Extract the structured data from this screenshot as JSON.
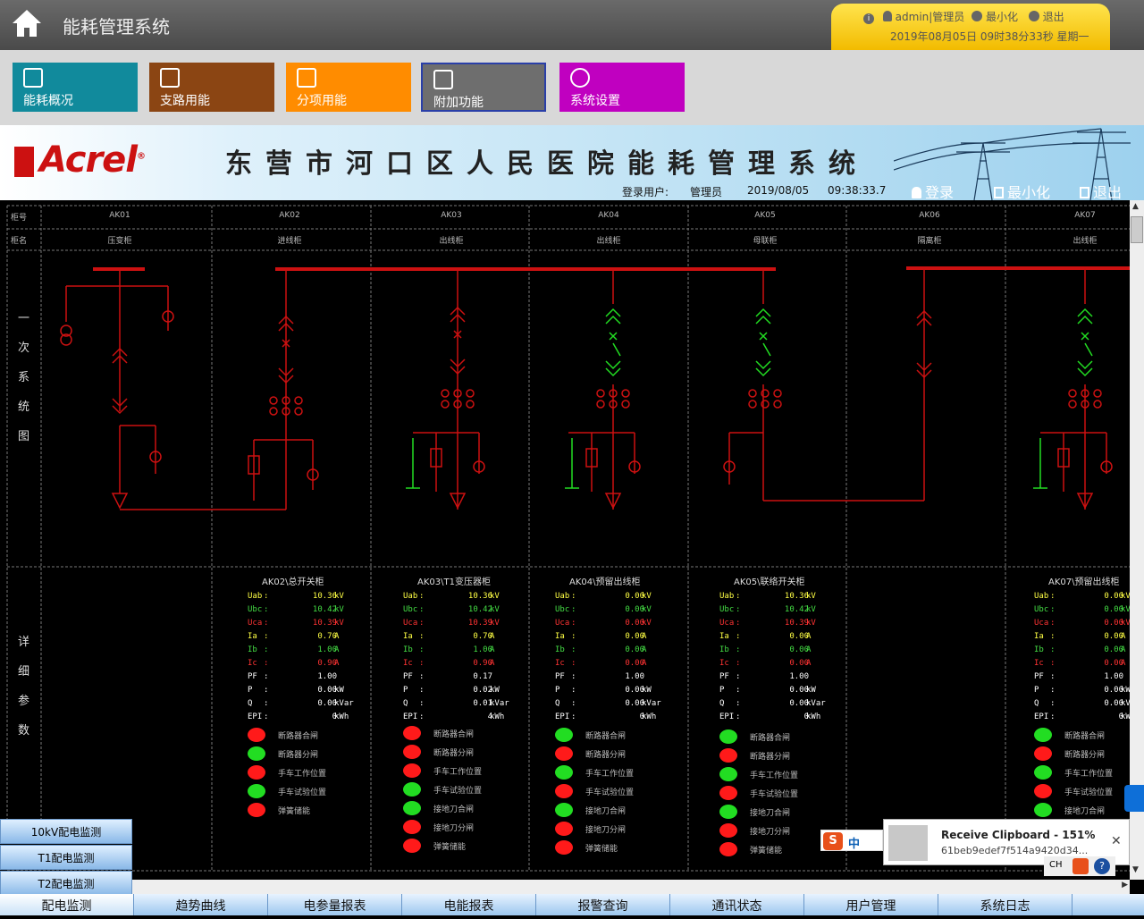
{
  "app": {
    "title": "能耗管理系统"
  },
  "user_box": {
    "user_label": "admin|管理员",
    "minimize": "最小化",
    "exit": "退出",
    "datetime": "2019年08月05日  09时38分33秒  星期一"
  },
  "modules": [
    {
      "label": "能耗概况",
      "color": "#118a9c",
      "icon": "chart-gauge-icon"
    },
    {
      "label": "支路用能",
      "color": "#8b4513",
      "icon": "line-chart-icon"
    },
    {
      "label": "分项用能",
      "color": "#ff8c00",
      "icon": "person-icon"
    },
    {
      "label": "附加功能",
      "color": "#6e6e6e",
      "icon": "pulse-icon"
    },
    {
      "label": "系统设置",
      "color": "#c000c0",
      "icon": "gear-icon"
    }
  ],
  "banner": {
    "logo": "Acrel",
    "title": "东营市河口区人民医院能耗管理系统",
    "login_label": "登录用户:",
    "login_user": "管理员",
    "date": "2019/08/05",
    "time": "09:38:33.7",
    "btn_login": "登录",
    "btn_min": "最小化",
    "btn_exit": "退出"
  },
  "grid": {
    "row_label_no": "柜号",
    "row_label_name": "柜名",
    "section_primary": "一次系统图",
    "section_detail": "详细参数",
    "cabinets": [
      {
        "no": "AK01",
        "name": "压变柜"
      },
      {
        "no": "AK02",
        "name": "进线柜"
      },
      {
        "no": "AK03",
        "name": "出线柜"
      },
      {
        "no": "AK04",
        "name": "出线柜"
      },
      {
        "no": "AK05",
        "name": "母联柜"
      },
      {
        "no": "AK06",
        "name": "隔离柜"
      },
      {
        "no": "AK07",
        "name": "出线柜"
      }
    ]
  },
  "panels": [
    {
      "title": "AK02\\总开关柜",
      "rows": [
        {
          "k": "Uab",
          "v": "10.36",
          "u": "kV",
          "c": "#ffff44"
        },
        {
          "k": "Ubc",
          "v": "10.42",
          "u": "kV",
          "c": "#44dd44"
        },
        {
          "k": "Uca",
          "v": "10.39",
          "u": "kV",
          "c": "#ff3333"
        },
        {
          "k": "Ia",
          "v": "0.70",
          "u": "A",
          "c": "#ffff44"
        },
        {
          "k": "Ib",
          "v": "1.00",
          "u": "A",
          "c": "#44dd44"
        },
        {
          "k": "Ic",
          "v": "0.90",
          "u": "A",
          "c": "#ff3333"
        },
        {
          "k": "PF",
          "v": "1.00",
          "u": "",
          "c": "#ffffff"
        },
        {
          "k": "P",
          "v": "0.00",
          "u": "kW",
          "c": "#ffffff"
        },
        {
          "k": "Q",
          "v": "0.00",
          "u": "kVar",
          "c": "#ffffff"
        },
        {
          "k": "EPI",
          "v": "0",
          "u": "kWh",
          "c": "#ffffff"
        }
      ],
      "status": [
        {
          "t": "断路器合闸",
          "on": false
        },
        {
          "t": "断路器分闸",
          "on": true
        },
        {
          "t": "手车工作位置",
          "on": false
        },
        {
          "t": "手车试验位置",
          "on": true
        },
        {
          "t": "弹簧储能",
          "on": false
        }
      ]
    },
    {
      "title": "AK03\\T1变压器柜",
      "rows": [
        {
          "k": "Uab",
          "v": "10.36",
          "u": "kV",
          "c": "#ffff44"
        },
        {
          "k": "Ubc",
          "v": "10.42",
          "u": "kV",
          "c": "#44dd44"
        },
        {
          "k": "Uca",
          "v": "10.39",
          "u": "kV",
          "c": "#ff3333"
        },
        {
          "k": "Ia",
          "v": "0.70",
          "u": "A",
          "c": "#ffff44"
        },
        {
          "k": "Ib",
          "v": "1.00",
          "u": "A",
          "c": "#44dd44"
        },
        {
          "k": "Ic",
          "v": "0.90",
          "u": "A",
          "c": "#ff3333"
        },
        {
          "k": "PF",
          "v": "0.17",
          "u": "",
          "c": "#ffffff"
        },
        {
          "k": "P",
          "v": "0.02",
          "u": "kW",
          "c": "#ffffff"
        },
        {
          "k": "Q",
          "v": "0.01",
          "u": "kVar",
          "c": "#ffffff"
        },
        {
          "k": "EPI",
          "v": "4",
          "u": "kWh",
          "c": "#ffffff"
        }
      ],
      "status": [
        {
          "t": "断路器合闸",
          "on": false
        },
        {
          "t": "断路器分闸",
          "on": false
        },
        {
          "t": "手车工作位置",
          "on": false
        },
        {
          "t": "手车试验位置",
          "on": true
        },
        {
          "t": "接地刀合闸",
          "on": true
        },
        {
          "t": "接地刀分闸",
          "on": false
        },
        {
          "t": "弹簧储能",
          "on": false
        }
      ]
    },
    {
      "title": "AK04\\预留出线柜",
      "rows": [
        {
          "k": "Uab",
          "v": "0.00",
          "u": "kV",
          "c": "#ffff44"
        },
        {
          "k": "Ubc",
          "v": "0.00",
          "u": "kV",
          "c": "#44dd44"
        },
        {
          "k": "Uca",
          "v": "0.00",
          "u": "kV",
          "c": "#ff3333"
        },
        {
          "k": "Ia",
          "v": "0.00",
          "u": "A",
          "c": "#ffff44"
        },
        {
          "k": "Ib",
          "v": "0.00",
          "u": "A",
          "c": "#44dd44"
        },
        {
          "k": "Ic",
          "v": "0.00",
          "u": "A",
          "c": "#ff3333"
        },
        {
          "k": "PF",
          "v": "1.00",
          "u": "",
          "c": "#ffffff"
        },
        {
          "k": "P",
          "v": "0.00",
          "u": "kW",
          "c": "#ffffff"
        },
        {
          "k": "Q",
          "v": "0.00",
          "u": "kVar",
          "c": "#ffffff"
        },
        {
          "k": "EPI",
          "v": "0",
          "u": "kWh",
          "c": "#ffffff"
        }
      ],
      "status": [
        {
          "t": "断路器合闸",
          "on": true
        },
        {
          "t": "断路器分闸",
          "on": false
        },
        {
          "t": "手车工作位置",
          "on": true
        },
        {
          "t": "手车试验位置",
          "on": false
        },
        {
          "t": "接地刀合闸",
          "on": true
        },
        {
          "t": "接地刀分闸",
          "on": false
        },
        {
          "t": "弹簧储能",
          "on": false
        }
      ]
    },
    {
      "title": "AK05\\联络开关柜",
      "rows": [
        {
          "k": "Uab",
          "v": "10.36",
          "u": "kV",
          "c": "#ffff44"
        },
        {
          "k": "Ubc",
          "v": "10.42",
          "u": "kV",
          "c": "#44dd44"
        },
        {
          "k": "Uca",
          "v": "10.39",
          "u": "kV",
          "c": "#ff3333"
        },
        {
          "k": "Ia",
          "v": "0.00",
          "u": "A",
          "c": "#ffff44"
        },
        {
          "k": "Ib",
          "v": "0.00",
          "u": "A",
          "c": "#44dd44"
        },
        {
          "k": "Ic",
          "v": "0.00",
          "u": "A",
          "c": "#ff3333"
        },
        {
          "k": "PF",
          "v": "1.00",
          "u": "",
          "c": "#ffffff"
        },
        {
          "k": "P",
          "v": "0.00",
          "u": "kW",
          "c": "#ffffff"
        },
        {
          "k": "Q",
          "v": "0.00",
          "u": "kVar",
          "c": "#ffffff"
        },
        {
          "k": "EPI",
          "v": "0",
          "u": "kWh",
          "c": "#ffffff"
        }
      ],
      "status": [
        {
          "t": "断路器合闸",
          "on": true
        },
        {
          "t": "断路器分闸",
          "on": false
        },
        {
          "t": "手车工作位置",
          "on": true
        },
        {
          "t": "手车试验位置",
          "on": false
        },
        {
          "t": "接地刀合闸",
          "on": true
        },
        {
          "t": "接地刀分闸",
          "on": false
        },
        {
          "t": "弹簧储能",
          "on": false
        }
      ]
    },
    {
      "title": "AK07\\预留出线柜",
      "rows": [
        {
          "k": "Uab",
          "v": "0.00",
          "u": "kV",
          "c": "#ffff44"
        },
        {
          "k": "Ubc",
          "v": "0.00",
          "u": "kV",
          "c": "#44dd44"
        },
        {
          "k": "Uca",
          "v": "0.00",
          "u": "kV",
          "c": "#ff3333"
        },
        {
          "k": "Ia",
          "v": "0.00",
          "u": "A",
          "c": "#ffff44"
        },
        {
          "k": "Ib",
          "v": "0.00",
          "u": "A",
          "c": "#44dd44"
        },
        {
          "k": "Ic",
          "v": "0.00",
          "u": "A",
          "c": "#ff3333"
        },
        {
          "k": "PF",
          "v": "1.00",
          "u": "",
          "c": "#ffffff"
        },
        {
          "k": "P",
          "v": "0.00",
          "u": "kW",
          "c": "#ffffff"
        },
        {
          "k": "Q",
          "v": "0.00",
          "u": "kVar",
          "c": "#ffffff"
        },
        {
          "k": "EPI",
          "v": "0",
          "u": "kWh",
          "c": "#ffffff"
        }
      ],
      "status": [
        {
          "t": "断路器合闸",
          "on": true
        },
        {
          "t": "断路器分闸",
          "on": false
        },
        {
          "t": "手车工作位置",
          "on": true
        },
        {
          "t": "手车试验位置",
          "on": false
        },
        {
          "t": "接地刀合闸",
          "on": true
        }
      ]
    }
  ],
  "side_menu": [
    "10kV配电监测",
    "T1配电监测",
    "T2配电监测"
  ],
  "nav": [
    "配电监测",
    "趋势曲线",
    "电参量报表",
    "电能报表",
    "报警查询",
    "通讯状态",
    "用户管理",
    "系统日志"
  ],
  "popup": {
    "title": "Receive Clipboard - 151%",
    "text": "61beb9edef7f514a9420d34..."
  },
  "ime": {
    "label": "中",
    "lang": "CH"
  },
  "colors": {
    "active_red": "#ff1a1a",
    "active_green": "#22dd22",
    "line_red": "#cc1111"
  }
}
